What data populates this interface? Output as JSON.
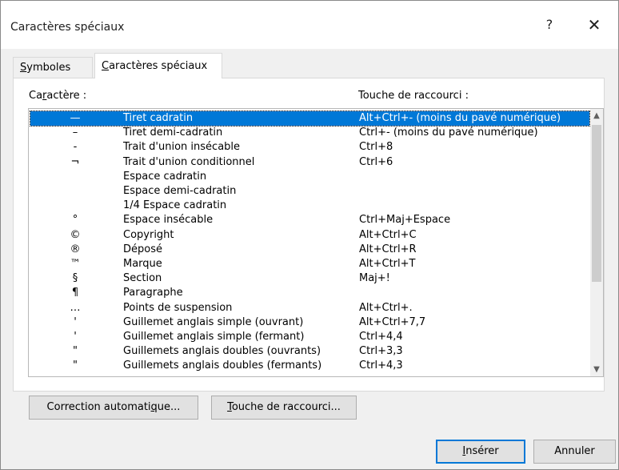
{
  "window": {
    "title": "Caractères spéciaux",
    "help_label": "?",
    "close_label": "✕"
  },
  "tabs": [
    {
      "label_pre": "",
      "label_ul": "S",
      "label_post": "ymboles",
      "active": false
    },
    {
      "label_pre": "",
      "label_ul": "C",
      "label_post": "aractères spéciaux",
      "active": true
    }
  ],
  "list": {
    "header_char_pre": "Ca",
    "header_char_ul": "r",
    "header_char_post": "actère :",
    "header_shortcut": "Touche de raccourci :",
    "rows": [
      {
        "symbol": "—",
        "name": "Tiret cadratin",
        "shortcut": "Alt+Ctrl+- (moins du pavé numérique)",
        "selected": true
      },
      {
        "symbol": "–",
        "name": "Tiret demi-cadratin",
        "shortcut": "Ctrl+- (moins du pavé numérique)",
        "selected": false
      },
      {
        "symbol": "-",
        "name": "Trait d'union insécable",
        "shortcut": "Ctrl+8",
        "selected": false
      },
      {
        "symbol": "¬",
        "name": "Trait d'union conditionnel",
        "shortcut": "Ctrl+6",
        "selected": false
      },
      {
        "symbol": "",
        "name": "Espace cadratin",
        "shortcut": "",
        "selected": false
      },
      {
        "symbol": "",
        "name": "Espace demi-cadratin",
        "shortcut": "",
        "selected": false
      },
      {
        "symbol": "",
        "name": "1/4 Espace cadratin",
        "shortcut": "",
        "selected": false
      },
      {
        "symbol": "°",
        "name": "Espace insécable",
        "shortcut": "Ctrl+Maj+Espace",
        "selected": false
      },
      {
        "symbol": "©",
        "name": "Copyright",
        "shortcut": "Alt+Ctrl+C",
        "selected": false
      },
      {
        "symbol": "®",
        "name": "Déposé",
        "shortcut": "Alt+Ctrl+R",
        "selected": false
      },
      {
        "symbol": "™",
        "name": "Marque",
        "shortcut": "Alt+Ctrl+T",
        "selected": false
      },
      {
        "symbol": "§",
        "name": "Section",
        "shortcut": "Maj+!",
        "selected": false
      },
      {
        "symbol": "¶",
        "name": "Paragraphe",
        "shortcut": "",
        "selected": false
      },
      {
        "symbol": "…",
        "name": "Points de suspension",
        "shortcut": "Alt+Ctrl+.",
        "selected": false
      },
      {
        "symbol": "'",
        "name": "Guillemet anglais simple (ouvrant)",
        "shortcut": "Alt+Ctrl+7,7",
        "selected": false
      },
      {
        "symbol": "'",
        "name": "Guillemet anglais simple (fermant)",
        "shortcut": "Ctrl+4,4",
        "selected": false
      },
      {
        "symbol": "\"",
        "name": "Guillemets anglais doubles (ouvrants)",
        "shortcut": "Ctrl+3,3",
        "selected": false
      },
      {
        "symbol": "\"",
        "name": "Guillemets anglais doubles (fermants)",
        "shortcut": "Ctrl+4,3",
        "selected": false
      }
    ]
  },
  "buttons": {
    "autocorrect_pre": "Correction automati",
    "autocorrect_ul": "q",
    "autocorrect_post": "ue...",
    "shortcut_pre": "",
    "shortcut_ul": "T",
    "shortcut_post": "ouche de raccourci...",
    "insert_pre": "",
    "insert_ul": "I",
    "insert_post": "nsérer",
    "cancel": "Annuler"
  },
  "colors": {
    "selection": "#0078d7",
    "dialog_bg": "#f0f0f0"
  }
}
